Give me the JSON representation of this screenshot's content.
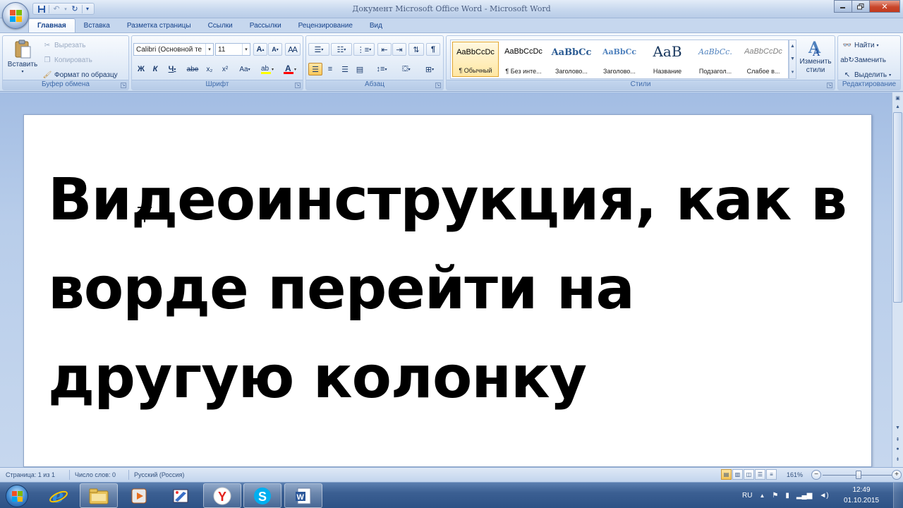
{
  "window": {
    "title": "Документ Microsoft Office Word - Microsoft Word",
    "minimize_icon": "minimize-icon",
    "maximize_icon": "restore-icon",
    "close_glyph": "✕"
  },
  "ribbon_tabs": [
    "Главная",
    "Вставка",
    "Разметка страницы",
    "Ссылки",
    "Рассылки",
    "Рецензирование",
    "Вид"
  ],
  "clipboard": {
    "paste": "Вставить",
    "cut": "Вырезать",
    "copy": "Копировать",
    "format_painter": "Формат по образцу",
    "label": "Буфер обмена"
  },
  "font": {
    "family": "Calibri (Основной те",
    "size": "11",
    "bold": "Ж",
    "italic": "К",
    "underline": "Ч",
    "strike": "abe",
    "subscript": "x₂",
    "superscript": "x²",
    "change_case": "Aa",
    "grow": "A",
    "shrink": "A",
    "label": "Шрифт"
  },
  "paragraph": {
    "label": "Абзац",
    "pilcrow": "¶"
  },
  "styles": {
    "items": [
      {
        "sample": "AaBbCcDc",
        "name": "¶ Обычный"
      },
      {
        "sample": "AaBbCcDc",
        "name": "¶ Без инте..."
      },
      {
        "sample": "AaBbCc",
        "name": "Заголово..."
      },
      {
        "sample": "AaBbCc",
        "name": "Заголово..."
      },
      {
        "sample": "AaB",
        "name": "Название"
      },
      {
        "sample": "AaBbCc.",
        "name": "Подзагол..."
      },
      {
        "sample": "AaBbCcDc",
        "name": "Слабое в..."
      }
    ],
    "change_styles": "Изменить стили",
    "label": "Стили"
  },
  "editing": {
    "find": "Найти",
    "replace": "Заменить",
    "select": "Выделить",
    "label": "Редактирование"
  },
  "document": {
    "text": "Видеоинструкция, как в ворде перейти на другую колонку"
  },
  "status": {
    "page": "Страница: 1 из 1",
    "words": "Число слов: 0",
    "language": "Русский (Россия)",
    "zoom": "161%",
    "zoom_level_percent": 161
  },
  "taskbar": {
    "apps": [
      "internet-explorer",
      "file-explorer",
      "media-player",
      "paint",
      "yandex-browser",
      "skype",
      "microsoft-word"
    ],
    "lang": "RU",
    "time": "12:49",
    "date": "01.10.2015"
  }
}
